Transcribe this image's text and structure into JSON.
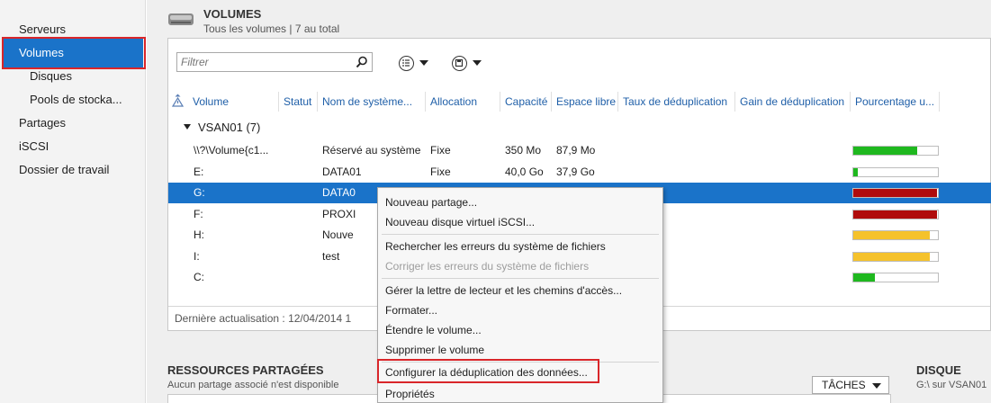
{
  "sidebar": {
    "items": [
      {
        "label": "Serveurs"
      },
      {
        "label": "Volumes"
      },
      {
        "label": "Disques"
      },
      {
        "label": "Pools de stocka..."
      },
      {
        "label": "Partages"
      },
      {
        "label": "iSCSI"
      },
      {
        "label": "Dossier de travail"
      }
    ]
  },
  "volumes": {
    "title": "VOLUMES",
    "subtitle": "Tous les volumes | 7 au total",
    "filter_placeholder": "Filtrer",
    "columns": [
      "Volume",
      "Statut",
      "Nom de système...",
      "Allocation",
      "Capacité",
      "Espace libre",
      "Taux de déduplication",
      "Gain de déduplication",
      "Pourcentage u..."
    ],
    "group_label": "VSAN01 (7)",
    "rows": [
      {
        "volume": "\\\\?\\Volume{c1...",
        "status": "",
        "name": "Réservé au système",
        "allocation": "Fixe",
        "capacity": "350 Mo",
        "free": "87,9 Mo",
        "usage": 0.75,
        "color": "#1fb81f"
      },
      {
        "volume": "E:",
        "status": "",
        "name": "DATA01",
        "allocation": "Fixe",
        "capacity": "40,0 Go",
        "free": "37,9 Go",
        "usage": 0.05,
        "color": "#1fb81f"
      },
      {
        "volume": "G:",
        "status": "",
        "name": "DATA0",
        "allocation": "",
        "capacity": "",
        "free": "",
        "usage": 0.99,
        "color": "#b00c0c"
      },
      {
        "volume": "F:",
        "status": "",
        "name": "PROXI",
        "allocation": "",
        "capacity": "",
        "free": "",
        "usage": 0.99,
        "color": "#b00c0c"
      },
      {
        "volume": "H:",
        "status": "",
        "name": "Nouve",
        "allocation": "",
        "capacity": "",
        "free": "",
        "usage": 0.9,
        "color": "#f5c22c"
      },
      {
        "volume": "I:",
        "status": "",
        "name": "test",
        "allocation": "",
        "capacity": "",
        "free": "",
        "usage": 0.9,
        "color": "#f5c22c"
      },
      {
        "volume": "C:",
        "status": "",
        "name": "",
        "allocation": "",
        "capacity": "",
        "free": "",
        "usage": 0.25,
        "color": "#1fb81f"
      }
    ],
    "last_refresh": "Dernière actualisation : 12/04/2014 1"
  },
  "shares": {
    "title": "RESSOURCES PARTAGÉES",
    "subtitle": "Aucun partage associé n'est disponible",
    "tasks_label": "TÂCHES"
  },
  "disk": {
    "title": "DISQUE",
    "subtitle": "G:\\ sur VSAN01"
  },
  "context_menu": {
    "items": [
      {
        "label": "Nouveau partage...",
        "disabled": false
      },
      {
        "label": "Nouveau disque virtuel iSCSI...",
        "disabled": false
      },
      {
        "label": "Rechercher les erreurs du système de fichiers",
        "disabled": false
      },
      {
        "label": "Corriger les erreurs du système de fichiers",
        "disabled": true
      },
      {
        "label": "Gérer la lettre de lecteur et les chemins d'accès...",
        "disabled": false
      },
      {
        "label": "Formater...",
        "disabled": false
      },
      {
        "label": "Étendre le volume...",
        "disabled": false
      },
      {
        "label": "Supprimer le volume",
        "disabled": false
      },
      {
        "label": "Configurer la déduplication des données...",
        "disabled": false
      },
      {
        "label": "Propriétés",
        "disabled": false
      }
    ]
  },
  "colors": {
    "accent": "#1a73c9",
    "highlight": "#d9262a",
    "column_header": "#1f5fa8"
  }
}
